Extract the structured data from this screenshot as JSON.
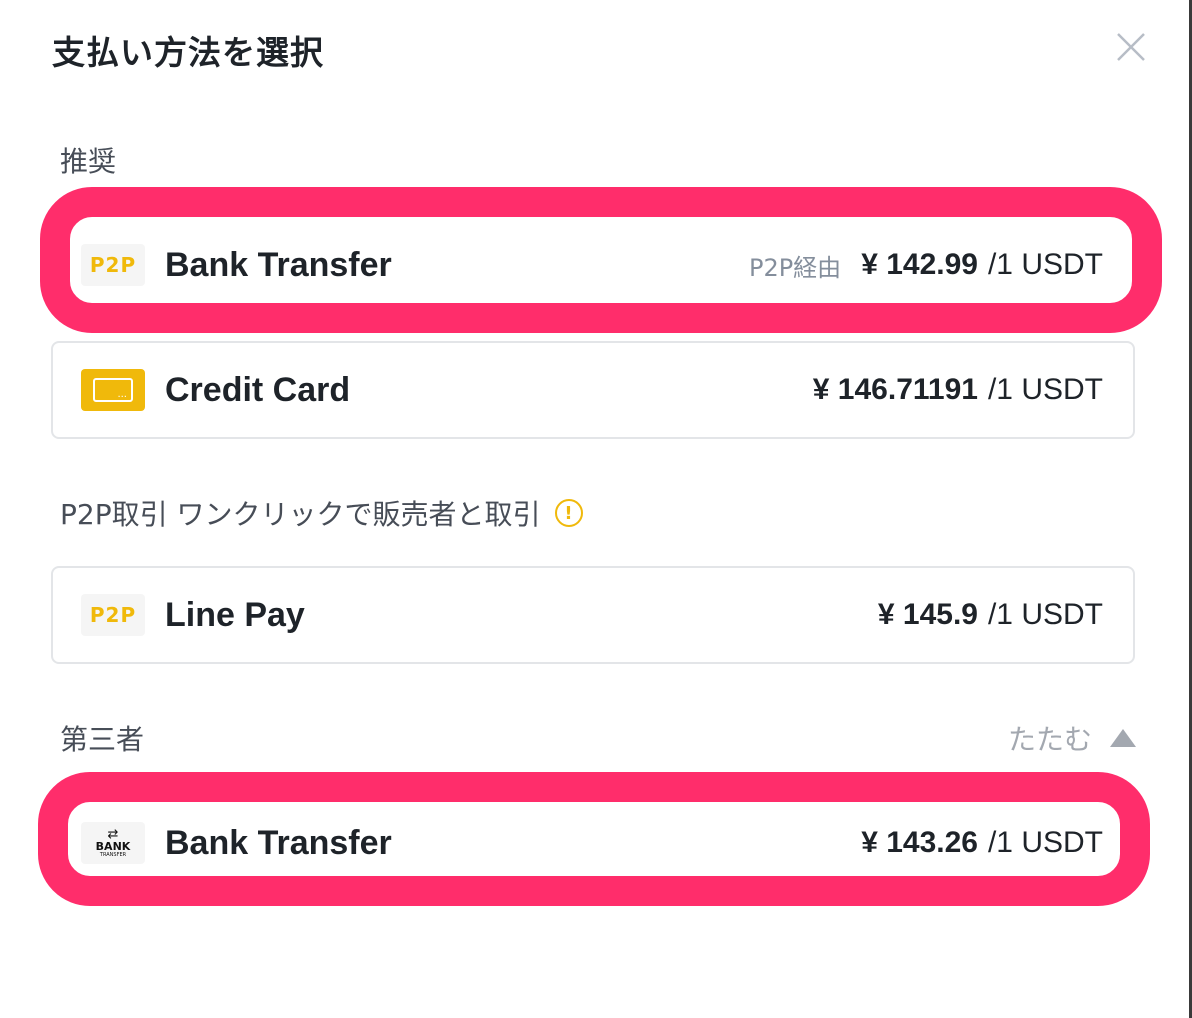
{
  "dialog": {
    "title": "支払い方法を選択"
  },
  "sections": {
    "recommended": {
      "label": "推奨"
    },
    "p2p": {
      "label": "P2P取引 ワンクリックで販売者と取引"
    },
    "third_party": {
      "label": "第三者",
      "collapse_label": "たたむ"
    }
  },
  "methods": [
    {
      "logo_text": "P2P",
      "name": "Bank Transfer",
      "via": "P2P経由",
      "price": "¥ 142.99",
      "unit": "/1 USDT"
    },
    {
      "logo_icon": "credit-card-icon",
      "name": "Credit Card",
      "price": "¥ 146.71191",
      "unit": "/1 USDT"
    },
    {
      "logo_text": "P2P",
      "name": "Line Pay",
      "price": "¥ 145.9",
      "unit": "/1 USDT"
    },
    {
      "logo_text": "BANK",
      "logo_subtext": "TRANSFER",
      "name": "Bank Transfer",
      "price": "¥ 143.26",
      "unit": "/1 USDT"
    }
  ],
  "colors": {
    "accent": "#f0b90b",
    "highlight": "#ff2d6b",
    "muted": "#848e9c"
  }
}
